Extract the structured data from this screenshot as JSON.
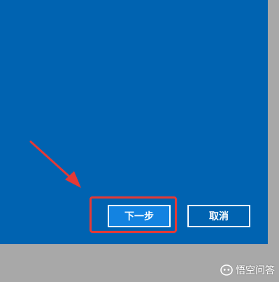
{
  "dialog": {
    "next_button_label": "下一步",
    "cancel_button_label": "取消"
  },
  "annotation": {
    "highlight_color": "#e53935",
    "arrow_color": "#e53935"
  },
  "watermark": {
    "text": "悟空问答"
  },
  "colors": {
    "dialog_background": "#0063b1",
    "primary_button": "#1383e1",
    "backdrop": "#a8a8a8"
  }
}
